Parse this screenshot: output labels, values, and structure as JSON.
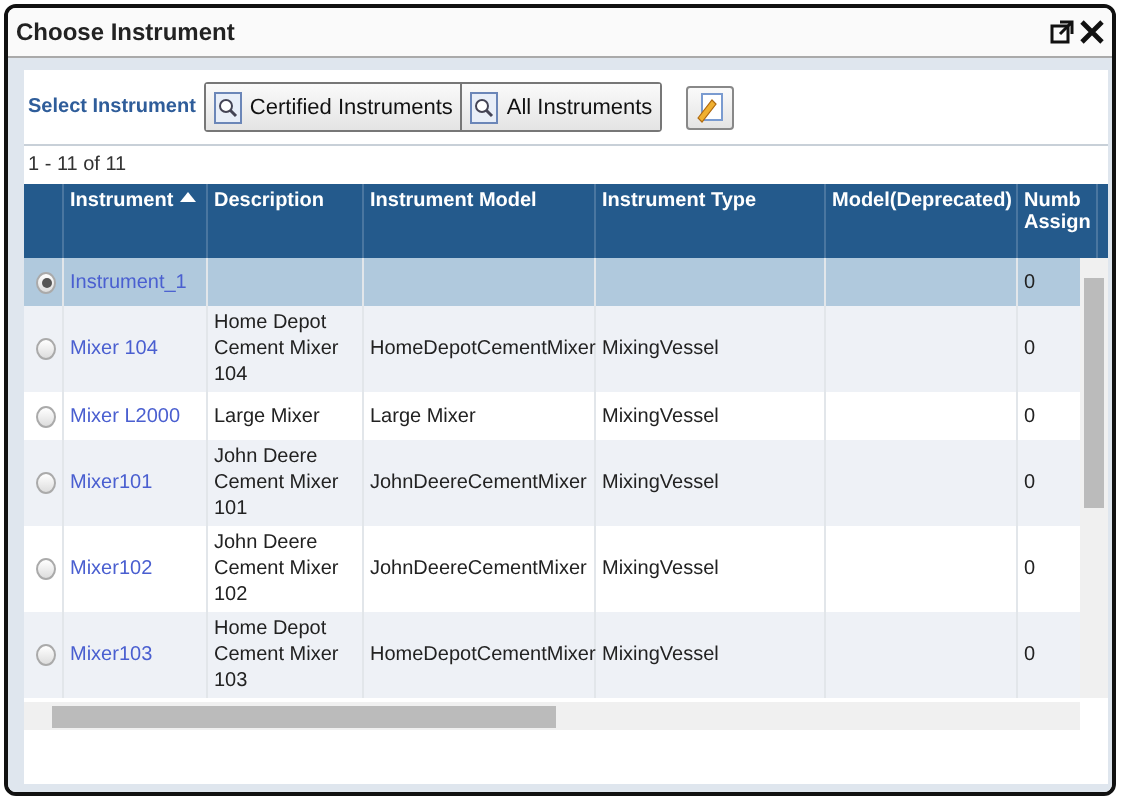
{
  "window": {
    "title": "Choose Instrument"
  },
  "toolbar": {
    "label": "Select Instrument",
    "buttons": [
      "Certified Instruments",
      "All Instruments"
    ]
  },
  "pager": "1 - 11 of 11",
  "table": {
    "columns": [
      {
        "label": "Instrument",
        "sorted": true
      },
      {
        "label": "Description",
        "sorted": false
      },
      {
        "label": "Instrument Model",
        "sorted": false
      },
      {
        "label": "Instrument Type",
        "sorted": false
      },
      {
        "label": "Model(Deprecated)",
        "sorted": false
      },
      {
        "label": "Numb Assign",
        "sorted": false
      }
    ],
    "rows": [
      {
        "selected": true,
        "instrument": "Instrument_1",
        "assigned": "0"
      },
      {
        "selected": false,
        "instrument": "Mixer 104",
        "description": "Home Depot Cement Mixer 104",
        "model": "HomeDepotCementMixer",
        "type": "MixingVessel",
        "assigned": "0"
      },
      {
        "selected": false,
        "instrument": "Mixer L2000",
        "description": "Large Mixer",
        "model": "Large Mixer",
        "type": "MixingVessel",
        "assigned": "0"
      },
      {
        "selected": false,
        "instrument": "Mixer101",
        "description": "John Deere Cement Mixer 101",
        "model": "JohnDeereCementMixer",
        "type": "MixingVessel",
        "assigned": "0"
      },
      {
        "selected": false,
        "instrument": "Mixer102",
        "description": "John Deere Cement Mixer 102",
        "model": "JohnDeereCementMixer",
        "type": "MixingVessel",
        "assigned": "0"
      },
      {
        "selected": false,
        "instrument": "Mixer103",
        "description": "Home Depot Cement Mixer 103",
        "model": "HomeDepotCementMixer",
        "type": "MixingVessel",
        "assigned": "0"
      }
    ]
  }
}
